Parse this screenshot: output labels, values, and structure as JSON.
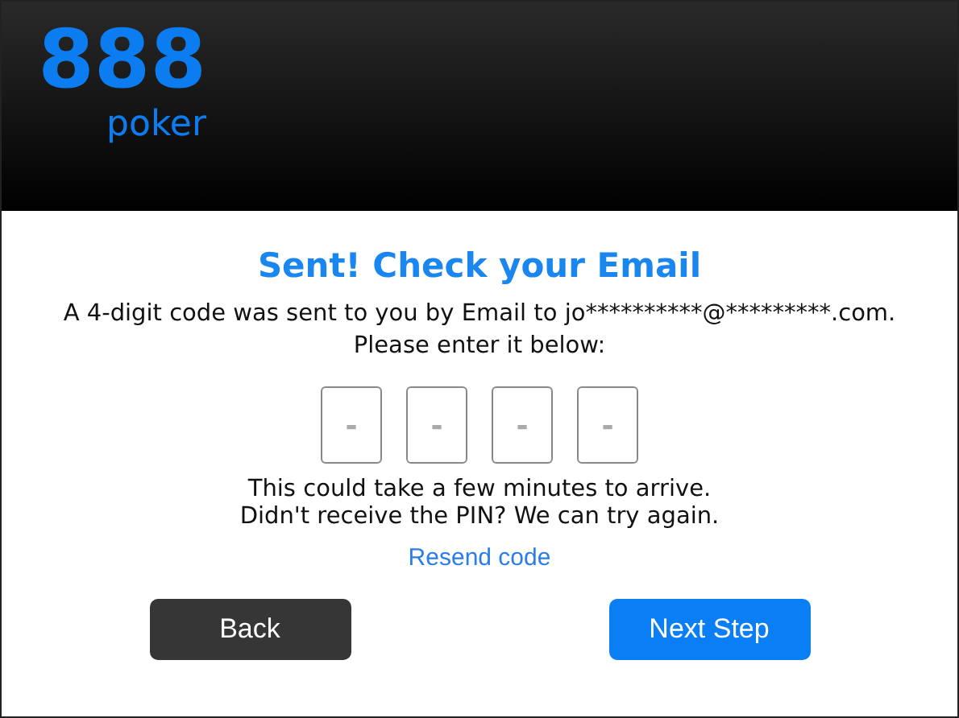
{
  "logo": {
    "mark": "888",
    "word": "poker"
  },
  "title": "Sent! Check your Email",
  "message": [
    "A 4-digit code was sent to you by Email to jo**********@*********.com.",
    "Please enter it below:"
  ],
  "code_fields": [
    {
      "placeholder": "-"
    },
    {
      "placeholder": "-"
    },
    {
      "placeholder": "-"
    },
    {
      "placeholder": "-"
    }
  ],
  "notes": [
    "This could take a few minutes to arrive.",
    "Didn't receive the PIN? We can try again."
  ],
  "resend_link": "Resend code",
  "buttons": [
    {
      "label": "Back",
      "kind": "secondary"
    },
    {
      "label": "Next Step",
      "kind": "primary"
    }
  ]
}
